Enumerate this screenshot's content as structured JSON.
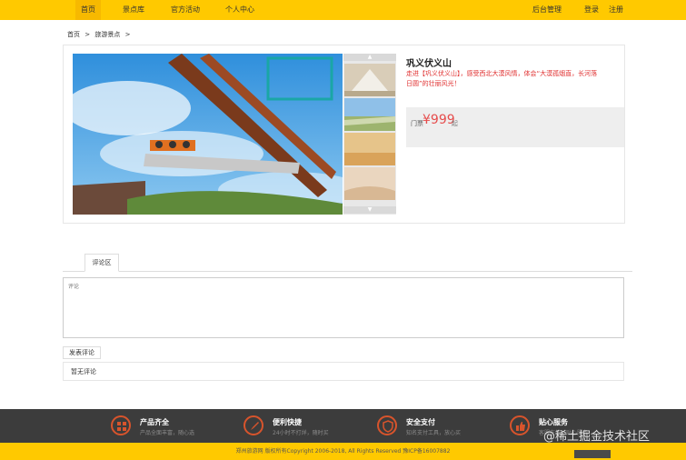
{
  "nav": {
    "left": [
      "首页",
      "景点库",
      "官方活动",
      "个人中心"
    ],
    "admin": "后台管理",
    "login": "登录",
    "register": "注册"
  },
  "breadcrumb": [
    "首页",
    ">",
    "旅游景点",
    ">"
  ],
  "product": {
    "title": "巩义伏义山",
    "desc": "走进【巩义伏义山】，感受西北大漠风情，体会“大漠孤烟直，长河落日圆”的壮丽风光！",
    "price_label": "门票",
    "price": "¥999",
    "price_unit": "起"
  },
  "comments": {
    "tab": "评论区",
    "placeholder": "评论",
    "submit": "发表评论",
    "empty": "暂无评论"
  },
  "footer": {
    "features": [
      {
        "title": "产品齐全",
        "sub": "产品全面丰富，随心选",
        "icon": "grid-icon"
      },
      {
        "title": "便利快捷",
        "sub": "24小时不打烊，随时买",
        "icon": "rocket-icon"
      },
      {
        "title": "安全支付",
        "sub": "知名支付工具，放心买",
        "icon": "shield-icon"
      },
      {
        "title": "贴心服务",
        "sub": "客服在线，贴心服务",
        "icon": "thumbs-up-icon"
      }
    ],
    "copyright": "郑州旅游网 版权所有Copyright 2006-2018, All Rights Reserved 豫ICP备16007882",
    "watermark": "@稀土掘金技术社区"
  },
  "colors": {
    "brand": "#ffc900",
    "accent": "#e64c4c",
    "footer_bg": "#3c3c3c"
  }
}
